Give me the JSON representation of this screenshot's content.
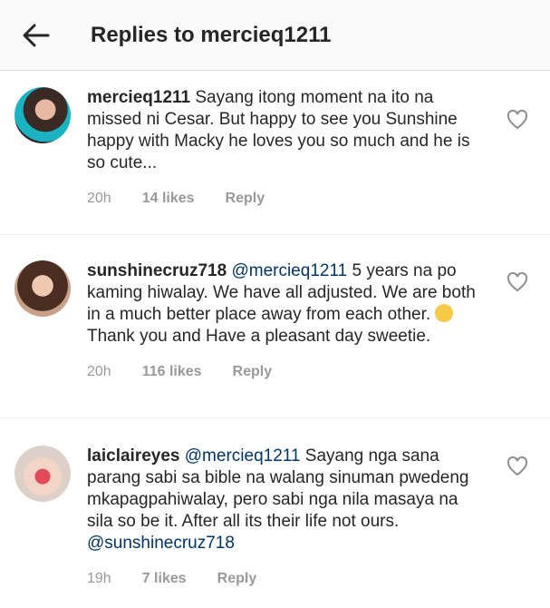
{
  "header": {
    "title": "Replies to mercieq1211",
    "back_icon": "arrow-left-icon"
  },
  "comments": [
    {
      "username": "mercieq1211",
      "mention": "",
      "text": "Sayang itong moment na ito na missed ni Cesar. But happy to see you Sunshine happy with Macky  he loves you so much and he is so cute...",
      "time": "20h",
      "likes": "14 likes",
      "reply": "Reply"
    },
    {
      "username": "sunshinecruz718",
      "mention": "@mercieq1211",
      "text": "5 years na po kaming hiwalay. We have all adjusted. We are both in a much better place away from each other.",
      "text_after_emoji": "Thank you and Have a pleasant day sweetie.",
      "time": "20h",
      "likes": "116 likes",
      "reply": "Reply"
    },
    {
      "username": "laiclaireyes",
      "mention": "@mercieq1211",
      "text": "Sayang nga sana parang sabi sa bible na walang sinuman pwedeng mkapagpahiwalay, pero sabi nga nila masaya na sila so be it. After all its their life not ours.",
      "mention_end": "@sunshinecruz718",
      "time": "19h",
      "likes": "7 likes",
      "reply": "Reply"
    }
  ],
  "icons": {
    "like": "heart-outline-icon",
    "emoji": "winking-face-emoji-icon"
  }
}
